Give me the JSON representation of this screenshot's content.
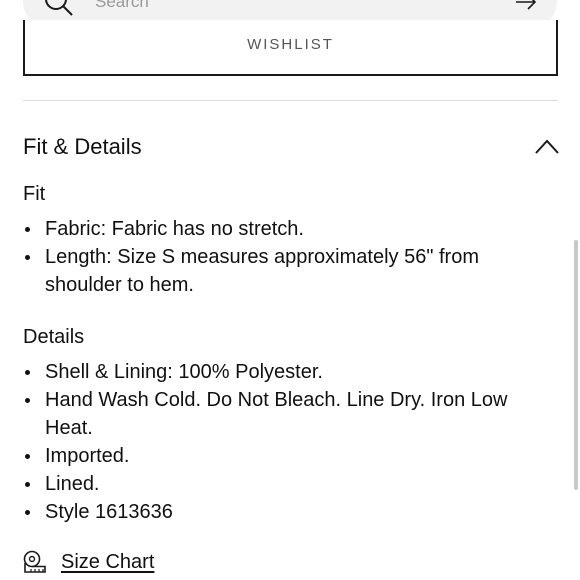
{
  "search": {
    "placeholder": "Search",
    "icon": "search-icon",
    "submit_icon": "arrow-right-icon"
  },
  "wishlist": {
    "label": "Wishlist"
  },
  "fit_details": {
    "title": "Fit & Details",
    "toggle_icon": "chevron-up-icon",
    "fit": {
      "heading": "Fit",
      "items": [
        "Fabric: Fabric has no stretch.",
        "Length: Size S measures approximately 56\" from shoulder to hem."
      ]
    },
    "details": {
      "heading": "Details",
      "items": [
        "Shell & Lining: 100% Polyester.",
        "Hand Wash Cold. Do Not Bleach. Line Dry. Iron Low Heat.",
        "Imported.",
        "Lined.",
        "Style 1613636"
      ]
    }
  },
  "size_chart": {
    "label": "Size Chart",
    "icon": "measuring-tape-icon"
  }
}
